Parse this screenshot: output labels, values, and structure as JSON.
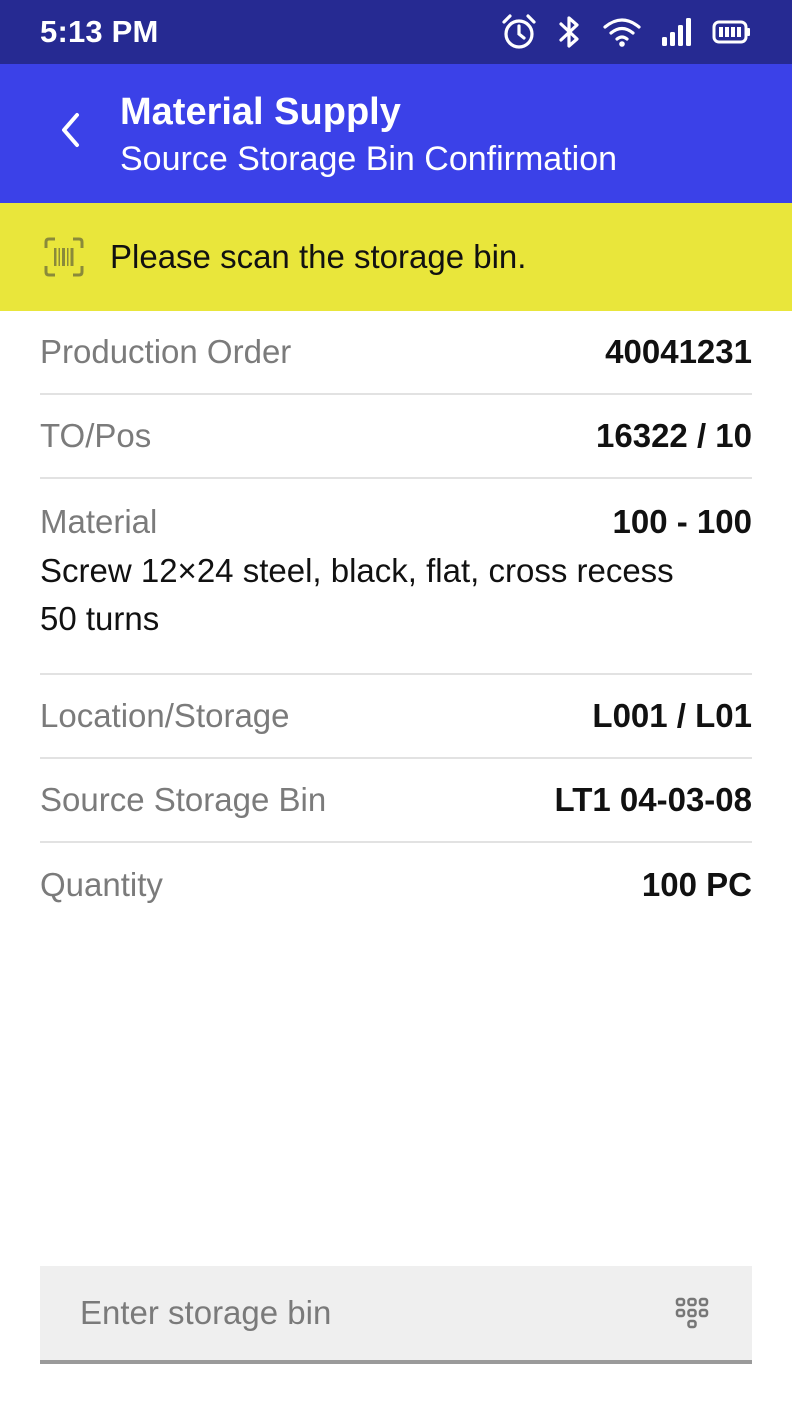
{
  "status_bar": {
    "time": "5:13 PM",
    "icons": [
      "alarm-icon",
      "bluetooth-icon",
      "wifi-icon",
      "signal-icon",
      "battery-icon"
    ]
  },
  "header": {
    "title": "Material Supply",
    "subtitle": "Source Storage Bin Confirmation",
    "back_icon": "chevron-left-icon"
  },
  "banner": {
    "icon": "barcode-scan-icon",
    "text": "Please scan the storage bin."
  },
  "details": {
    "production_order": {
      "label": "Production Order",
      "value": "40041231"
    },
    "to_pos": {
      "label": "TO/Pos",
      "value": "16322 / 10"
    },
    "material": {
      "label": "Material",
      "value": "100 - 100",
      "description_line1": "Screw 12×24 steel, black, flat, cross recess",
      "description_line2": "50 turns"
    },
    "location_storage": {
      "label": "Location/Storage",
      "value": "L001 / L01"
    },
    "source_storage_bin": {
      "label": "Source Storage Bin",
      "value": "LT1 04-03-08"
    },
    "quantity": {
      "label": "Quantity",
      "value": "100 PC"
    }
  },
  "input": {
    "placeholder": "Enter storage bin",
    "value": "",
    "keypad_icon": "keypad-icon"
  },
  "colors": {
    "status_bar": "#262a92",
    "app_bar": "#3b41e8",
    "banner": "#e9e63b",
    "banner_icon": "#8a8a3a"
  }
}
